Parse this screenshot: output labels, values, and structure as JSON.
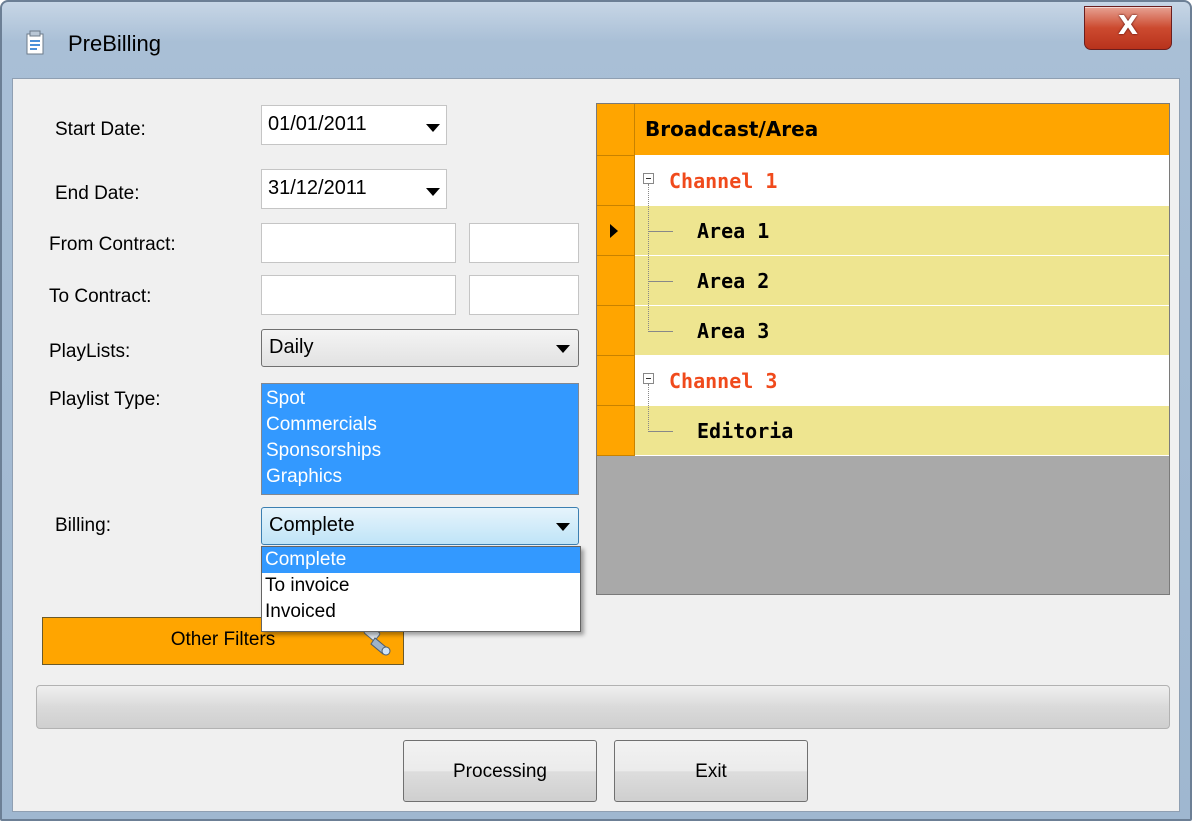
{
  "window": {
    "title": "PreBilling",
    "close_symbol": "X"
  },
  "form": {
    "start_date": {
      "label": "Start Date:",
      "value": "01/01/2011"
    },
    "end_date": {
      "label": "End Date:",
      "value": "31/12/2011"
    },
    "from_contract": {
      "label": "From Contract:",
      "value1": "",
      "value2": ""
    },
    "to_contract": {
      "label": "To Contract:",
      "value1": "",
      "value2": ""
    },
    "playlists": {
      "label": "PlayLists:",
      "value": "Daily"
    },
    "playlist_type": {
      "label": "Playlist Type:",
      "items": [
        "Spot",
        "Commercials",
        "Sponsorships",
        "Graphics"
      ]
    },
    "billing": {
      "label": "Billing:",
      "value": "Complete",
      "options": [
        "Complete",
        "To invoice",
        "Invoiced"
      ],
      "selected_index": 0
    },
    "other_filters": {
      "label": "Other Filters"
    }
  },
  "grid": {
    "header": "Broadcast/Area",
    "rows": [
      {
        "text": "Channel 1",
        "type": "channel"
      },
      {
        "text": "Area 1",
        "type": "area",
        "current": true
      },
      {
        "text": "Area 2",
        "type": "area"
      },
      {
        "text": "Area 3",
        "type": "area"
      },
      {
        "text": "Channel 3",
        "type": "channel"
      },
      {
        "text": "Editoria",
        "type": "area"
      }
    ]
  },
  "progress": {
    "value": 0
  },
  "buttons": {
    "processing": "Processing",
    "exit": "Exit"
  },
  "colors": {
    "accent": "#ffa500",
    "channel_text": "#f04a1c",
    "area_row": "#eee590",
    "selection": "#3399ff"
  }
}
